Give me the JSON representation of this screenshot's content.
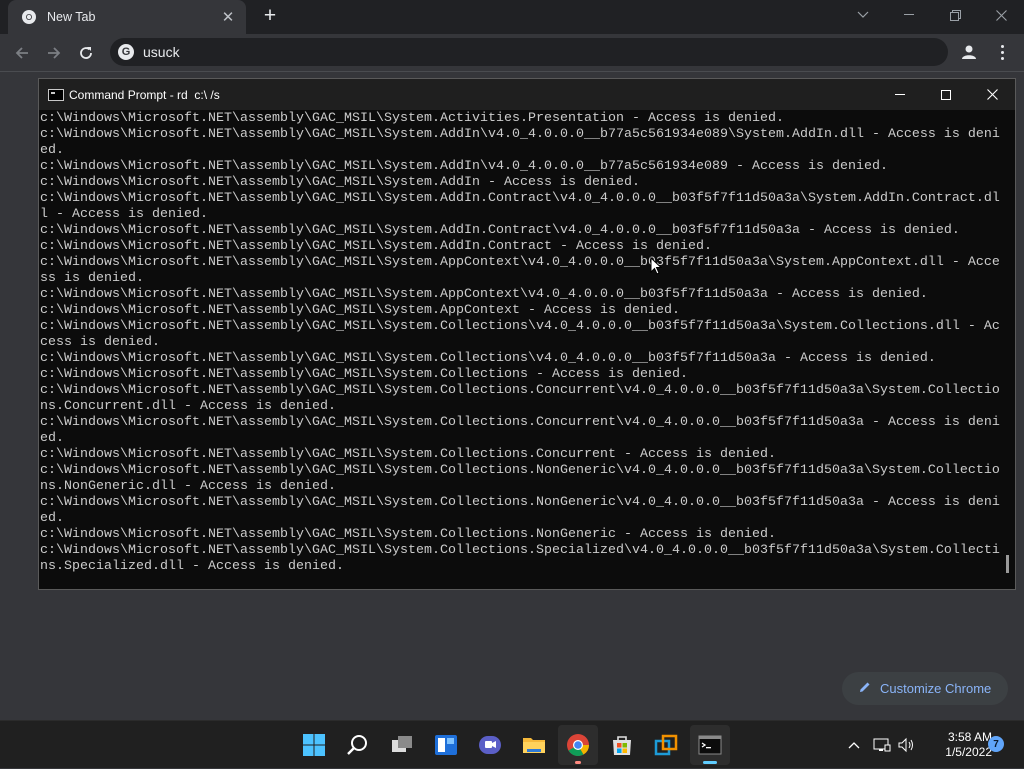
{
  "browser": {
    "tab_title": "New Tab",
    "omnibox_text": "usuck",
    "customize_label": "Customize Chrome"
  },
  "cmd": {
    "title": "Command Prompt - rd  c:\\ /s",
    "lines": [
      "c:\\Windows\\Microsoft.NET\\assembly\\GAC_MSIL\\System.Activities.Presentation - Access is denied.",
      "c:\\Windows\\Microsoft.NET\\assembly\\GAC_MSIL\\System.AddIn\\v4.0_4.0.0.0__b77a5c561934e089\\System.AddIn.dll - Access is deni",
      "ed.",
      "c:\\Windows\\Microsoft.NET\\assembly\\GAC_MSIL\\System.AddIn\\v4.0_4.0.0.0__b77a5c561934e089 - Access is denied.",
      "c:\\Windows\\Microsoft.NET\\assembly\\GAC_MSIL\\System.AddIn - Access is denied.",
      "c:\\Windows\\Microsoft.NET\\assembly\\GAC_MSIL\\System.AddIn.Contract\\v4.0_4.0.0.0__b03f5f7f11d50a3a\\System.AddIn.Contract.dl",
      "l - Access is denied.",
      "c:\\Windows\\Microsoft.NET\\assembly\\GAC_MSIL\\System.AddIn.Contract\\v4.0_4.0.0.0__b03f5f7f11d50a3a - Access is denied.",
      "c:\\Windows\\Microsoft.NET\\assembly\\GAC_MSIL\\System.AddIn.Contract - Access is denied.",
      "c:\\Windows\\Microsoft.NET\\assembly\\GAC_MSIL\\System.AppContext\\v4.0_4.0.0.0__b03f5f7f11d50a3a\\System.AppContext.dll - Acce",
      "ss is denied.",
      "c:\\Windows\\Microsoft.NET\\assembly\\GAC_MSIL\\System.AppContext\\v4.0_4.0.0.0__b03f5f7f11d50a3a - Access is denied.",
      "c:\\Windows\\Microsoft.NET\\assembly\\GAC_MSIL\\System.AppContext - Access is denied.",
      "c:\\Windows\\Microsoft.NET\\assembly\\GAC_MSIL\\System.Collections\\v4.0_4.0.0.0__b03f5f7f11d50a3a\\System.Collections.dll - Ac",
      "cess is denied.",
      "c:\\Windows\\Microsoft.NET\\assembly\\GAC_MSIL\\System.Collections\\v4.0_4.0.0.0__b03f5f7f11d50a3a - Access is denied.",
      "c:\\Windows\\Microsoft.NET\\assembly\\GAC_MSIL\\System.Collections - Access is denied.",
      "c:\\Windows\\Microsoft.NET\\assembly\\GAC_MSIL\\System.Collections.Concurrent\\v4.0_4.0.0.0__b03f5f7f11d50a3a\\System.Collectio",
      "ns.Concurrent.dll - Access is denied.",
      "c:\\Windows\\Microsoft.NET\\assembly\\GAC_MSIL\\System.Collections.Concurrent\\v4.0_4.0.0.0__b03f5f7f11d50a3a - Access is deni",
      "ed.",
      "c:\\Windows\\Microsoft.NET\\assembly\\GAC_MSIL\\System.Collections.Concurrent - Access is denied.",
      "c:\\Windows\\Microsoft.NET\\assembly\\GAC_MSIL\\System.Collections.NonGeneric\\v4.0_4.0.0.0__b03f5f7f11d50a3a\\System.Collectio",
      "ns.NonGeneric.dll - Access is denied.",
      "c:\\Windows\\Microsoft.NET\\assembly\\GAC_MSIL\\System.Collections.NonGeneric\\v4.0_4.0.0.0__b03f5f7f11d50a3a - Access is deni",
      "ed.",
      "c:\\Windows\\Microsoft.NET\\assembly\\GAC_MSIL\\System.Collections.NonGeneric - Access is denied.",
      "c:\\Windows\\Microsoft.NET\\assembly\\GAC_MSIL\\System.Collections.Specialized\\v4.0_4.0.0.0__b03f5f7f11d50a3a\\System.Collectio",
      "ns.Specialized.dll - Access is denied."
    ]
  },
  "taskbar": {
    "apps": [
      "start-icon",
      "search-icon",
      "task-view-icon",
      "widgets-icon",
      "teams-chat-icon",
      "file-explorer-icon",
      "chrome-icon",
      "store-icon",
      "vmware-icon",
      "terminal-icon"
    ],
    "time": "3:58 AM",
    "date": "1/5/2022",
    "notification_count": "7"
  },
  "colors": {
    "accent": "#60cdff",
    "chrome_link": "#8ab4f8"
  }
}
